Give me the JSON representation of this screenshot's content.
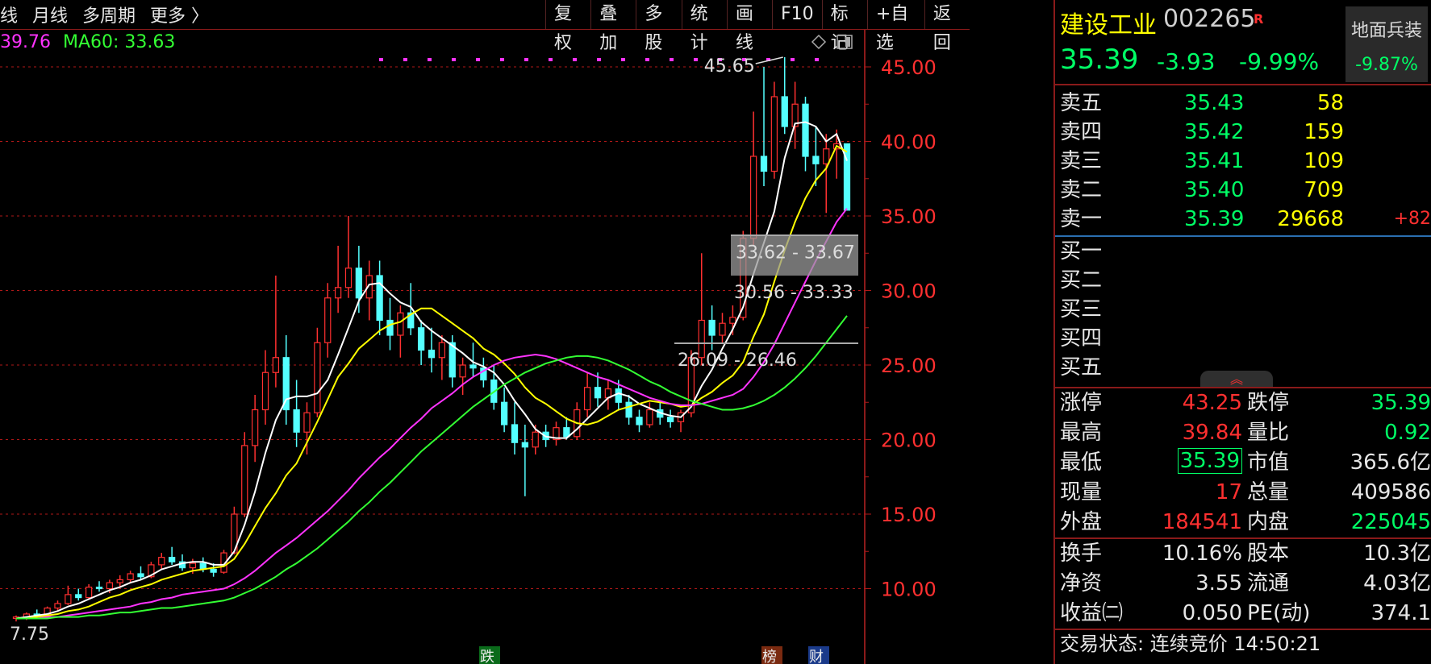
{
  "toolbar": {
    "left_items": [
      "线",
      "月线",
      "多周期",
      "更多 〉"
    ],
    "right_items": [
      "复权",
      "叠加",
      "多股",
      "统计",
      "画线",
      "F10",
      "标记",
      "+自选",
      "返回"
    ]
  },
  "ma_legend": {
    "ma30_value": "39.76",
    "ma60_label": "MA60: 33.63",
    "ma30_color": "#ff33ff",
    "ma60_color": "#33ff33"
  },
  "annotations": {
    "high_label": "45.65",
    "low_label": "7.75",
    "zone_upper": "33.62 - 33.67",
    "zone_mid": "30.56 - 33.33",
    "zone_lower": "26.09 - 26.46",
    "bottom_marks": [
      "跌",
      "榜",
      "财"
    ]
  },
  "chart_data": {
    "type": "candlestick",
    "y_axis_ticks": [
      "45.00",
      "40.00",
      "35.00",
      "30.00",
      "25.00",
      "20.00",
      "15.00",
      "10.00"
    ],
    "ylim": [
      7,
      47
    ],
    "candles": [
      [
        8.0,
        8.2,
        7.8,
        8.1
      ],
      [
        8.1,
        8.4,
        7.9,
        8.3
      ],
      [
        8.3,
        8.6,
        8.1,
        8.2
      ],
      [
        8.2,
        8.8,
        8.0,
        8.7
      ],
      [
        8.7,
        9.2,
        8.5,
        9.0
      ],
      [
        9.0,
        10.2,
        8.9,
        9.6
      ],
      [
        9.6,
        10.0,
        9.2,
        9.4
      ],
      [
        9.4,
        10.3,
        9.3,
        10.1
      ],
      [
        10.1,
        10.5,
        9.8,
        10.0
      ],
      [
        10.0,
        10.6,
        9.7,
        10.4
      ],
      [
        10.4,
        10.9,
        10.1,
        10.6
      ],
      [
        10.6,
        11.2,
        10.4,
        11.0
      ],
      [
        11.0,
        11.5,
        10.6,
        10.8
      ],
      [
        10.8,
        11.8,
        10.7,
        11.6
      ],
      [
        11.6,
        12.4,
        11.3,
        12.1
      ],
      [
        12.1,
        12.8,
        11.6,
        11.8
      ],
      [
        11.8,
        12.3,
        11.2,
        11.4
      ],
      [
        11.4,
        12.0,
        11.0,
        11.7
      ],
      [
        11.7,
        12.1,
        11.1,
        11.3
      ],
      [
        11.3,
        11.7,
        10.8,
        11.1
      ],
      [
        11.1,
        12.6,
        11.0,
        12.4
      ],
      [
        12.4,
        15.5,
        12.3,
        15.0
      ],
      [
        15.0,
        20.5,
        14.8,
        19.6
      ],
      [
        19.6,
        23.0,
        18.5,
        22.0
      ],
      [
        22.0,
        26.0,
        21.0,
        24.5
      ],
      [
        24.5,
        31.0,
        23.5,
        25.5
      ],
      [
        25.5,
        27.0,
        21.0,
        22.0
      ],
      [
        22.0,
        24.0,
        19.5,
        20.5
      ],
      [
        20.5,
        22.5,
        19.0,
        21.8
      ],
      [
        21.8,
        27.5,
        21.5,
        26.5
      ],
      [
        26.5,
        30.5,
        25.5,
        29.5
      ],
      [
        29.5,
        33.0,
        28.5,
        30.2
      ],
      [
        30.2,
        35.0,
        29.5,
        31.5
      ],
      [
        31.5,
        33.0,
        28.5,
        29.5
      ],
      [
        29.5,
        32.0,
        28.0,
        31.0
      ],
      [
        31.0,
        32.0,
        27.0,
        28.0
      ],
      [
        28.0,
        29.5,
        26.0,
        27.0
      ],
      [
        27.0,
        29.0,
        25.5,
        28.5
      ],
      [
        28.5,
        30.5,
        27.0,
        27.5
      ],
      [
        27.5,
        28.0,
        25.0,
        26.0
      ],
      [
        26.0,
        27.5,
        24.5,
        25.5
      ],
      [
        25.5,
        27.0,
        24.0,
        26.5
      ],
      [
        26.5,
        27.0,
        23.5,
        24.2
      ],
      [
        24.2,
        25.5,
        23.0,
        25.0
      ],
      [
        25.0,
        26.5,
        24.2,
        24.8
      ],
      [
        24.8,
        25.5,
        23.5,
        24.0
      ],
      [
        24.0,
        25.0,
        22.0,
        22.5
      ],
      [
        22.5,
        23.5,
        20.5,
        21.0
      ],
      [
        21.0,
        22.5,
        19.0,
        19.8
      ],
      [
        19.8,
        21.0,
        16.2,
        19.5
      ],
      [
        19.5,
        21.0,
        19.0,
        20.5
      ],
      [
        20.5,
        21.0,
        19.5,
        20.0
      ],
      [
        20.0,
        21.2,
        19.6,
        20.8
      ],
      [
        20.8,
        21.5,
        20.0,
        20.2
      ],
      [
        20.2,
        22.5,
        20.0,
        22.0
      ],
      [
        22.0,
        24.5,
        21.5,
        23.5
      ],
      [
        23.5,
        24.5,
        22.2,
        22.8
      ],
      [
        22.8,
        24.0,
        22.0,
        23.4
      ],
      [
        23.4,
        24.0,
        22.0,
        22.5
      ],
      [
        22.5,
        23.0,
        21.0,
        21.5
      ],
      [
        21.5,
        22.0,
        20.5,
        21.0
      ],
      [
        21.0,
        22.5,
        20.8,
        22.0
      ],
      [
        22.0,
        22.5,
        21.0,
        21.5
      ],
      [
        21.5,
        22.0,
        20.8,
        21.2
      ],
      [
        21.2,
        22.0,
        20.5,
        21.8
      ],
      [
        21.8,
        26.0,
        21.5,
        25.5
      ],
      [
        25.5,
        32.5,
        25.0,
        28.0
      ],
      [
        28.0,
        29.0,
        26.0,
        27.0
      ],
      [
        27.0,
        28.5,
        26.5,
        27.8
      ],
      [
        27.8,
        29.0,
        27.0,
        28.2
      ],
      [
        28.2,
        34.0,
        28.0,
        33.5
      ],
      [
        33.5,
        42.0,
        33.0,
        39.0
      ],
      [
        39.0,
        45.0,
        37.0,
        38.0
      ],
      [
        38.0,
        44.0,
        37.5,
        43.0
      ],
      [
        43.0,
        45.65,
        40.5,
        41.0
      ],
      [
        41.0,
        44.0,
        39.5,
        42.5
      ],
      [
        42.5,
        43.0,
        38.0,
        39.0
      ],
      [
        39.0,
        41.0,
        37.0,
        38.5
      ],
      [
        38.5,
        40.5,
        35.2,
        39.5
      ],
      [
        39.5,
        40.8,
        37.5,
        39.84
      ],
      [
        39.84,
        39.84,
        35.39,
        35.39
      ]
    ],
    "series": [
      {
        "name": "MA5",
        "color": "#ffffff",
        "values": [
          8.0,
          8.1,
          8.2,
          8.3,
          8.5,
          8.8,
          9.0,
          9.3,
          9.6,
          9.9,
          10.1,
          10.4,
          10.6,
          10.9,
          11.3,
          11.5,
          11.7,
          11.8,
          11.8,
          11.6,
          11.6,
          12.5,
          14.3,
          16.5,
          19.1,
          21.3,
          22.7,
          22.9,
          22.9,
          23.1,
          24.0,
          25.7,
          27.5,
          29.3,
          30.4,
          30.5,
          29.8,
          29.2,
          28.9,
          27.9,
          27.3,
          26.8,
          26.3,
          25.8,
          25.2,
          24.9,
          24.5,
          23.7,
          22.6,
          21.7,
          20.7,
          20.2,
          20.1,
          20.1,
          20.7,
          21.4,
          22.1,
          22.8,
          23.1,
          22.9,
          22.4,
          22.1,
          21.8,
          21.6,
          21.5,
          22.2,
          23.6,
          24.7,
          26.1,
          27.4,
          28.9,
          31.1,
          33.2,
          35.3,
          38.9,
          41.2,
          41.3,
          41.0,
          40.0,
          40.5,
          38.7
        ]
      },
      {
        "name": "MA10",
        "color": "#ffff00",
        "values": [
          8.0,
          8.0,
          8.1,
          8.2,
          8.3,
          8.5,
          8.6,
          8.8,
          9.1,
          9.4,
          9.6,
          9.9,
          10.1,
          10.3,
          10.6,
          10.8,
          11.0,
          11.2,
          11.3,
          11.4,
          11.5,
          12.0,
          13.0,
          14.2,
          15.4,
          16.4,
          17.6,
          18.4,
          19.8,
          21.2,
          22.7,
          24.2,
          25.1,
          26.1,
          26.7,
          27.3,
          27.7,
          27.9,
          28.4,
          28.8,
          28.8,
          28.3,
          27.8,
          27.3,
          26.8,
          26.1,
          25.7,
          25.1,
          24.4,
          23.5,
          22.8,
          22.4,
          21.9,
          21.4,
          21.1,
          21.0,
          21.2,
          21.6,
          22.0,
          22.2,
          22.4,
          22.6,
          22.5,
          22.4,
          22.2,
          22.3,
          22.8,
          23.2,
          23.8,
          24.3,
          25.2,
          26.9,
          28.4,
          30.6,
          32.7,
          34.6,
          36.2,
          37.4,
          38.2,
          39.7,
          39.3
        ]
      },
      {
        "name": "MA30",
        "color": "#ff33ff",
        "values": [
          8.0,
          8.0,
          8.0,
          8.1,
          8.1,
          8.2,
          8.3,
          8.4,
          8.5,
          8.6,
          8.7,
          8.8,
          9.0,
          9.1,
          9.3,
          9.4,
          9.6,
          9.7,
          9.8,
          9.9,
          10.0,
          10.3,
          10.7,
          11.2,
          11.8,
          12.4,
          12.9,
          13.4,
          14.0,
          14.6,
          15.2,
          15.9,
          16.6,
          17.4,
          18.1,
          18.8,
          19.4,
          20.1,
          20.8,
          21.4,
          22.1,
          22.6,
          23.1,
          23.7,
          24.2,
          24.6,
          25.0,
          25.3,
          25.5,
          25.6,
          25.7,
          25.6,
          25.4,
          25.1,
          24.8,
          24.5,
          24.2,
          24.0,
          23.7,
          23.4,
          23.1,
          22.8,
          22.6,
          22.4,
          22.3,
          22.3,
          22.4,
          22.6,
          22.8,
          23.0,
          23.4,
          24.2,
          25.2,
          26.4,
          27.8,
          29.2,
          30.6,
          32.0,
          33.3,
          34.6,
          35.5
        ]
      },
      {
        "name": "MA60",
        "color": "#33ff33",
        "values": [
          8.0,
          8.0,
          8.0,
          8.0,
          8.1,
          8.1,
          8.1,
          8.2,
          8.2,
          8.3,
          8.4,
          8.4,
          8.5,
          8.6,
          8.7,
          8.7,
          8.8,
          8.9,
          9.0,
          9.1,
          9.2,
          9.4,
          9.7,
          10.0,
          10.4,
          10.8,
          11.3,
          11.7,
          12.2,
          12.7,
          13.3,
          13.9,
          14.5,
          15.2,
          15.8,
          16.5,
          17.1,
          17.8,
          18.5,
          19.2,
          19.8,
          20.4,
          21.0,
          21.6,
          22.2,
          22.7,
          23.2,
          23.7,
          24.1,
          24.5,
          24.8,
          25.1,
          25.3,
          25.5,
          25.6,
          25.6,
          25.5,
          25.3,
          25.0,
          24.7,
          24.3,
          23.9,
          23.6,
          23.2,
          22.9,
          22.6,
          22.4,
          22.2,
          22.0,
          22.0,
          22.1,
          22.3,
          22.6,
          23.0,
          23.5,
          24.1,
          24.8,
          25.6,
          26.5,
          27.4,
          28.3
        ]
      }
    ]
  },
  "quote": {
    "name": "建设工业",
    "code": "002265",
    "tag": "R",
    "price": "35.39",
    "change": "-3.93",
    "change_pct": "-9.99%",
    "sector_name": "地面兵装",
    "sector_pct": "-9.87%"
  },
  "order_book": {
    "sells": [
      {
        "label": "卖五",
        "price": "35.43",
        "vol": "58",
        "extra": ""
      },
      {
        "label": "卖四",
        "price": "35.42",
        "vol": "159",
        "extra": ""
      },
      {
        "label": "卖三",
        "price": "35.41",
        "vol": "109",
        "extra": ""
      },
      {
        "label": "卖二",
        "price": "35.40",
        "vol": "709",
        "extra": ""
      },
      {
        "label": "卖一",
        "price": "35.39",
        "vol": "29668",
        "extra": "+82"
      }
    ],
    "buys": [
      {
        "label": "买一"
      },
      {
        "label": "买二"
      },
      {
        "label": "买三"
      },
      {
        "label": "买四"
      },
      {
        "label": "买五"
      }
    ]
  },
  "stats": {
    "limit_up_label": "涨停",
    "limit_up": "43.25",
    "limit_down_label": "跌停",
    "limit_down": "35.39",
    "high_label": "最高",
    "high": "39.84",
    "vol_ratio_label": "量比",
    "vol_ratio": "0.92",
    "low_label": "最低",
    "low": "35.39",
    "mcap_label": "市值",
    "mcap": "365.6亿",
    "cur_vol_label": "现量",
    "cur_vol": "17",
    "total_vol_label": "总量",
    "total_vol": "409586",
    "outer_label": "外盘",
    "outer": "184541",
    "inner_label": "内盘",
    "inner": "225045"
  },
  "stats2": {
    "turnover_label": "换手",
    "turnover": "10.16%",
    "capital_label": "股本",
    "capital": "10.3亿",
    "nav_label": "净资",
    "nav": "3.55",
    "float_label": "流通",
    "float": "4.03亿",
    "eps_label": "收益㈡",
    "eps": "0.050",
    "pe_label": "PE(动)",
    "pe": "374.1"
  },
  "status": {
    "label": "交易状态:",
    "state": "连续竞价",
    "time": "14:50:21"
  }
}
